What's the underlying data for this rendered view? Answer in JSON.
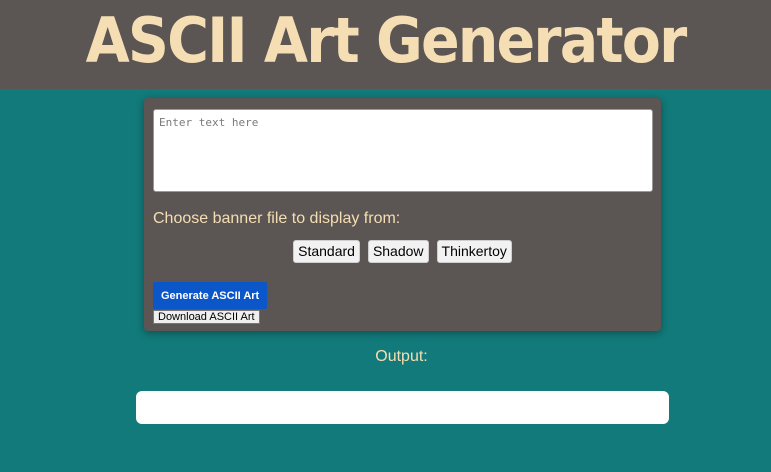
{
  "header": {
    "title": "ASCII Art Generator"
  },
  "form": {
    "text_placeholder": "Enter text here",
    "text_value": "",
    "banner_prompt": "Choose banner file to display from:",
    "banners": [
      "Standard",
      "Shadow",
      "Thinkertoy"
    ],
    "generate_label": "Generate ASCII Art",
    "download_label": "Download ASCII Art"
  },
  "output": {
    "label": "Output:",
    "content": ""
  },
  "colors": {
    "page_background": "#127a7a",
    "header_background": "#5b5553",
    "panel_background": "#5b5553",
    "title_color": "#f5deb3",
    "label_color": "#f5deb3",
    "generate_button": "#0b57c9"
  }
}
